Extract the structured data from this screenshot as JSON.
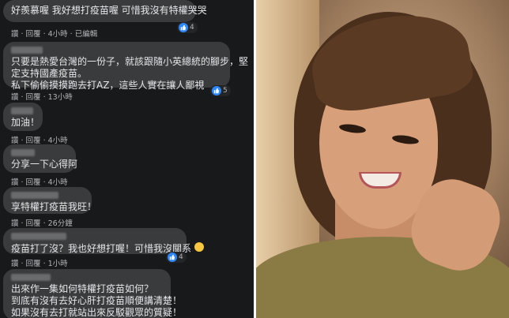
{
  "comments": [
    {
      "text_lines": [
        "好羨慕喔 我好想打疫苗喔 可惜我沒有特權哭哭"
      ],
      "meta": "讚 · 回覆 · 4小時 · 已編輯",
      "reaction": {
        "type": "like",
        "count": "4"
      }
    },
    {
      "text_lines": [
        "只要是熱愛台灣的一份子，就該跟隨小英總統的腳步，堅",
        "定支持國產疫苗。",
        "私下偷偷摸摸跑去打AZ，這些人實在讓人鄙視"
      ],
      "meta": "讚 · 回覆 · 13小時",
      "reaction": {
        "type": "like",
        "count": "5"
      }
    },
    {
      "text_lines": [
        "加油！"
      ],
      "meta": "讚 · 回覆 · 4小時"
    },
    {
      "text_lines": [
        "分享一下心得阿"
      ],
      "meta": "讚 · 回覆 · 4小時"
    },
    {
      "text_lines": [
        "享特權打疫苗我旺！"
      ],
      "meta": "讚 · 回覆 · 26分鐘"
    },
    {
      "text_lines": [
        "疫苗打了沒？我也好想打喔！可惜我沒關系"
      ],
      "meta": "讚 · 回覆 · 1小時",
      "reaction": {
        "type": "like",
        "count": "4"
      }
    },
    {
      "text_lines": [
        "出來作一集如何特權打疫苗如何？",
        "到底有沒有去好心肝打疫苗順便講清楚！",
        "如果沒有去打就站出來反駁觀眾的質疑！"
      ]
    }
  ],
  "colors": {
    "panel_bg": "#18191a",
    "bubble_bg": "#3a3b3c",
    "text": "#e4e6eb",
    "meta": "#b0b3b8",
    "like": "#2d88ff"
  },
  "icons": {
    "like": "thumbs-up-icon",
    "emoji": "sad-face-emoji-icon"
  }
}
